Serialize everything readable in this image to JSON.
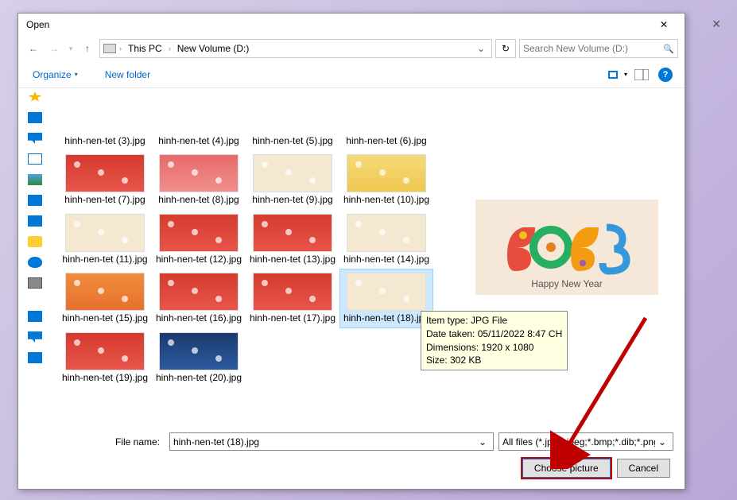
{
  "dialog": {
    "title": "Open",
    "close_glyph": "✕"
  },
  "nav": {
    "back_glyph": "←",
    "forward_glyph": "→",
    "recent_glyph": "▾",
    "up_glyph": "↑",
    "refresh_glyph": "↻"
  },
  "address": {
    "crumb1": "This PC",
    "crumb2": "New Volume (D:)",
    "sep": "›",
    "dropdown_glyph": "⌄"
  },
  "search": {
    "placeholder": "Search New Volume (D:)",
    "icon_glyph": "🔍"
  },
  "toolbar": {
    "organize": "Organize",
    "organize_caret": "▾",
    "new_folder": "New folder",
    "view_caret": "▾",
    "help_glyph": "?"
  },
  "files": [
    {
      "name": "hinh-nen-tet (3).jpg",
      "thumb": "noimg"
    },
    {
      "name": "hinh-nen-tet (4).jpg",
      "thumb": "noimg"
    },
    {
      "name": "hinh-nen-tet (5).jpg",
      "thumb": "noimg"
    },
    {
      "name": "hinh-nen-tet (6).jpg",
      "thumb": "noimg"
    },
    {
      "name": "hinh-nen-tet (7).jpg",
      "thumb": "t-red"
    },
    {
      "name": "hinh-nen-tet (8).jpg",
      "thumb": "t-pink"
    },
    {
      "name": "hinh-nen-tet (9).jpg",
      "thumb": "t-cream"
    },
    {
      "name": "hinh-nen-tet (10).jpg",
      "thumb": "t-yellow"
    },
    {
      "name": "hinh-nen-tet (11).jpg",
      "thumb": "t-cream"
    },
    {
      "name": "hinh-nen-tet (12).jpg",
      "thumb": "t-red"
    },
    {
      "name": "hinh-nen-tet (13).jpg",
      "thumb": "t-red"
    },
    {
      "name": "hinh-nen-tet (14).jpg",
      "thumb": "t-cream"
    },
    {
      "name": "hinh-nen-tet (15).jpg",
      "thumb": "t-orange"
    },
    {
      "name": "hinh-nen-tet (16).jpg",
      "thumb": "t-red"
    },
    {
      "name": "hinh-nen-tet (17).jpg",
      "thumb": "t-red"
    },
    {
      "name": "hinh-nen-tet (18).jpg",
      "thumb": "t-cream",
      "selected": true
    },
    {
      "name": "hinh-nen-tet (19).jpg",
      "thumb": "t-red"
    },
    {
      "name": "hinh-nen-tet (20).jpg",
      "thumb": "t-blue"
    }
  ],
  "tooltip": {
    "line1": "Item type: JPG File",
    "line2": "Date taken: 05/11/2022 8:47 CH",
    "line3": "Dimensions: 1920 x 1080",
    "line4": "Size: 302 KB"
  },
  "preview": {
    "caption": "Happy New Year"
  },
  "bottom": {
    "filename_label": "File name:",
    "filename_value": "hinh-nen-tet (18).jpg",
    "filter_text": "All files (*.jpg;*.jpeg;*.bmp;*.dib;*.png",
    "choose_label": "Choose picture",
    "cancel_label": "Cancel",
    "dd_glyph": "⌄"
  },
  "colors": {
    "accent": "#0078d7",
    "annotation": "#c00000"
  }
}
